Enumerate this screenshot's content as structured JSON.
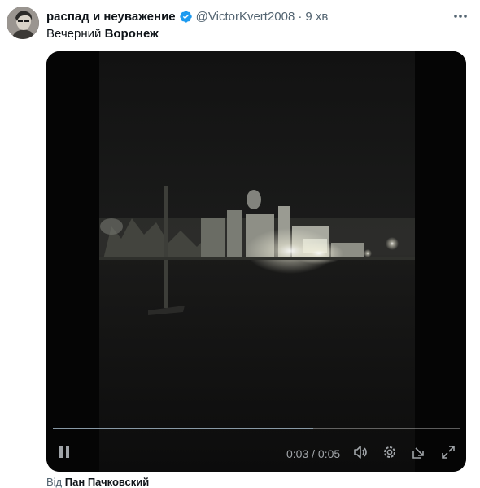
{
  "author": {
    "display_name": "распад и неуважение",
    "handle": "@VictorKvert2008",
    "separator": "·",
    "time": "9 хв",
    "verified": true
  },
  "tweet": {
    "text_plain": "Вечерний",
    "text_bold": "Воронеж"
  },
  "video": {
    "current_time": "0:03",
    "time_separator": "/",
    "duration": "0:05",
    "progress": 0.64,
    "icons": {
      "play_state": "pause-icon",
      "volume": "volume-icon",
      "settings": "gear-icon",
      "popout": "popout-icon",
      "fullscreen": "fullscreen-icon"
    }
  },
  "attribution": {
    "prefix": "Від",
    "creator": "Пан Пачковский"
  },
  "colors": {
    "verified": "#1d9bf0",
    "muted_text": "#536471",
    "text": "#0f1419"
  }
}
